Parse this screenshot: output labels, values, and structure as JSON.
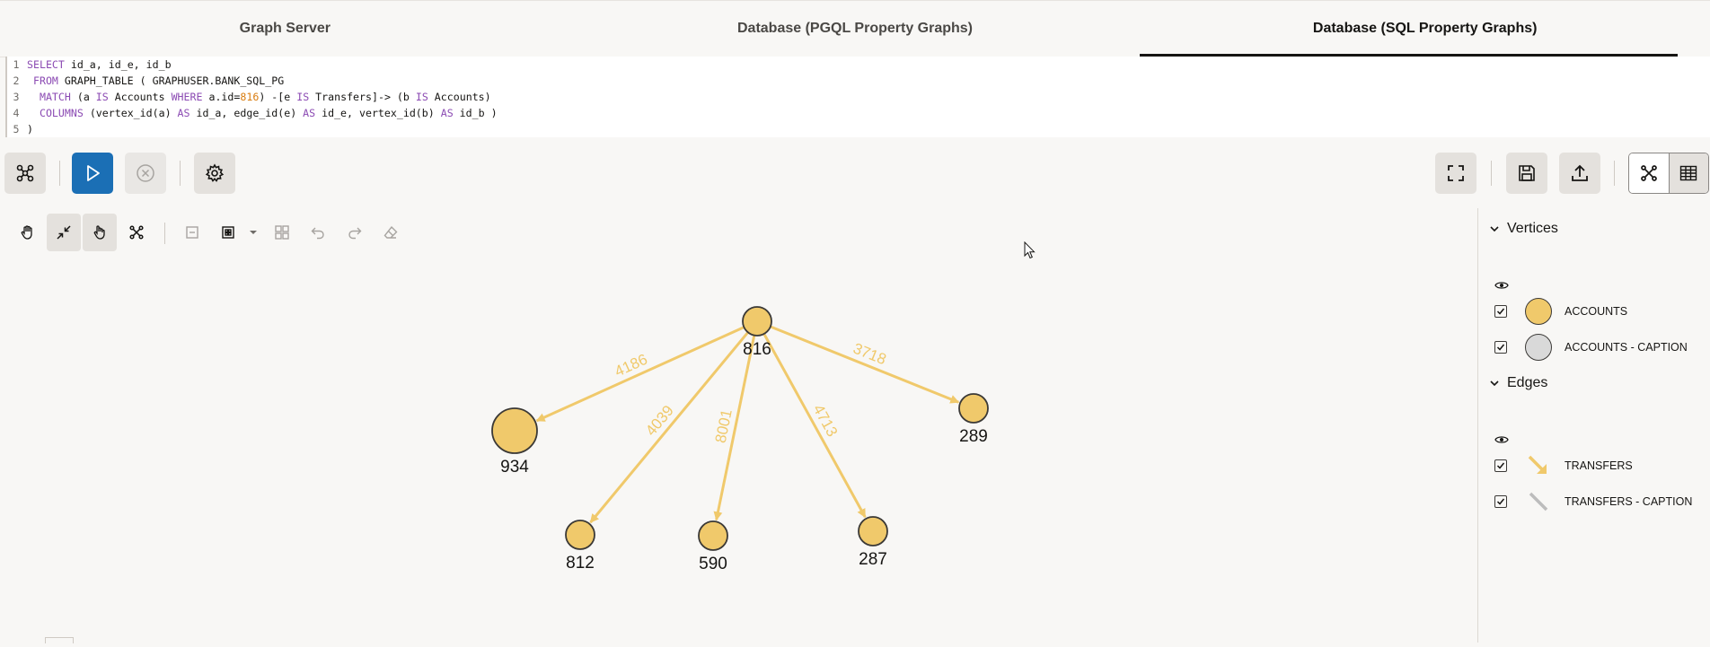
{
  "tabs": [
    {
      "label": "Graph Server",
      "active": false
    },
    {
      "label": "Database (PGQL Property Graphs)",
      "active": false
    },
    {
      "label": "Database (SQL Property Graphs)",
      "active": true
    }
  ],
  "editor": {
    "line_numbers": [
      "1",
      "2",
      "3",
      "4",
      "5"
    ],
    "lines": [
      [
        {
          "t": "kw",
          "v": "SELECT"
        },
        {
          "t": "plain",
          "v": " id_a, id_e, id_b"
        }
      ],
      [
        {
          "t": "plain",
          "v": " "
        },
        {
          "t": "kw",
          "v": "FROM"
        },
        {
          "t": "plain",
          "v": " GRAPH_TABLE ( GRAPHUSER.BANK_SQL_PG"
        }
      ],
      [
        {
          "t": "plain",
          "v": "  "
        },
        {
          "t": "kw",
          "v": "MATCH"
        },
        {
          "t": "plain",
          "v": " (a "
        },
        {
          "t": "kw",
          "v": "IS"
        },
        {
          "t": "plain",
          "v": " Accounts "
        },
        {
          "t": "kw",
          "v": "WHERE"
        },
        {
          "t": "plain",
          "v": " a.id="
        },
        {
          "t": "num",
          "v": "816"
        },
        {
          "t": "plain",
          "v": ") -[e "
        },
        {
          "t": "kw",
          "v": "IS"
        },
        {
          "t": "plain",
          "v": " Transfers]-> (b "
        },
        {
          "t": "kw",
          "v": "IS"
        },
        {
          "t": "plain",
          "v": " Accounts)"
        }
      ],
      [
        {
          "t": "plain",
          "v": "  "
        },
        {
          "t": "kw",
          "v": "COLUMNS"
        },
        {
          "t": "plain",
          "v": " (vertex_id(a) "
        },
        {
          "t": "kw",
          "v": "AS"
        },
        {
          "t": "plain",
          "v": " id_a, edge_id(e) "
        },
        {
          "t": "kw",
          "v": "AS"
        },
        {
          "t": "plain",
          "v": " id_e, vertex_id(b) "
        },
        {
          "t": "kw",
          "v": "AS"
        },
        {
          "t": "plain",
          "v": " id_b )"
        }
      ],
      [
        {
          "t": "plain",
          "v": ")"
        }
      ]
    ]
  },
  "toolbar": {
    "icons": [
      "graph-settings-icon",
      "run-icon",
      "cancel-icon",
      "gear-icon",
      "fullscreen-icon",
      "save-icon",
      "upload-icon",
      "graph-view-icon",
      "table-view-icon"
    ]
  },
  "graph_toolbar": {
    "icons": [
      "hand-icon",
      "collapse-icon",
      "hand-select-icon",
      "network-icon",
      "minus-box-icon",
      "layout-grid-icon",
      "dropdown-caret-icon",
      "group-icon",
      "undo-icon",
      "redo-icon",
      "eraser-icon"
    ]
  },
  "graph": {
    "node_color": "#f0c96b",
    "edge_color": "#f0c96b",
    "nodes": [
      {
        "id": "816",
        "label": "816"
      },
      {
        "id": "934",
        "label": "934"
      },
      {
        "id": "812",
        "label": "812"
      },
      {
        "id": "590",
        "label": "590"
      },
      {
        "id": "287",
        "label": "287"
      },
      {
        "id": "289",
        "label": "289"
      }
    ],
    "edges": [
      {
        "source": "816",
        "target": "934",
        "label": "4186"
      },
      {
        "source": "816",
        "target": "812",
        "label": "4039"
      },
      {
        "source": "816",
        "target": "590",
        "label": "8001"
      },
      {
        "source": "816",
        "target": "287",
        "label": "4713"
      },
      {
        "source": "816",
        "target": "289",
        "label": "3718"
      }
    ]
  },
  "legend": {
    "vertices": {
      "title": "Vertices",
      "items": [
        {
          "label": "ACCOUNTS",
          "color": "#f0c96b",
          "checked": true
        },
        {
          "label": "ACCOUNTS - CAPTION",
          "color": "#d9d9d9",
          "checked": true
        }
      ]
    },
    "edges": {
      "title": "Edges",
      "items": [
        {
          "label": "TRANSFERS",
          "color": "#f0c96b",
          "checked": true
        },
        {
          "label": "TRANSFERS - CAPTION",
          "color": "#bcbcbc",
          "checked": true
        }
      ]
    }
  }
}
